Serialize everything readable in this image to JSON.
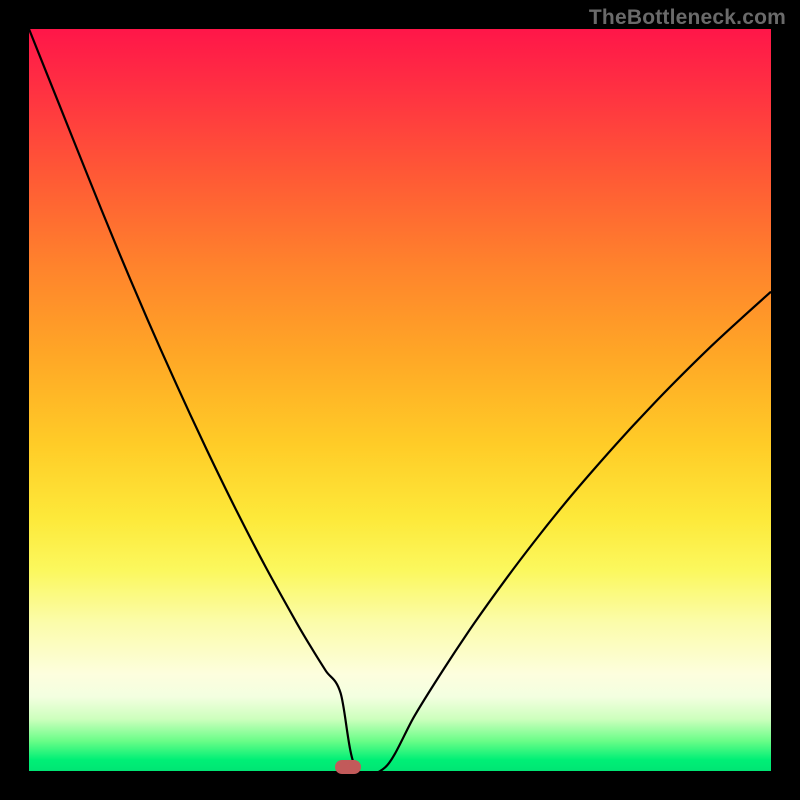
{
  "watermark": "TheBottleneck.com",
  "colors": {
    "frame": "#000000",
    "curve": "#000000",
    "marker": "#c25a5a"
  },
  "chart_data": {
    "type": "line",
    "title": "",
    "xlabel": "",
    "ylabel": "",
    "xlim": [
      0,
      100
    ],
    "ylim": [
      0,
      100
    ],
    "x": [
      0,
      4,
      8,
      12,
      16,
      20,
      24,
      28,
      32,
      36,
      38,
      40,
      42,
      44,
      48,
      52,
      56,
      60,
      64,
      68,
      72,
      76,
      80,
      84,
      88,
      92,
      96,
      100
    ],
    "values": [
      100,
      90,
      80,
      70.2,
      60.8,
      51.8,
      43.2,
      35,
      27.3,
      20.1,
      16.7,
      13.5,
      10.5,
      0.5,
      0.5,
      7.5,
      13.9,
      19.9,
      25.5,
      30.8,
      35.8,
      40.5,
      45,
      49.3,
      53.4,
      57.3,
      61,
      64.6
    ],
    "marker": {
      "x": 43,
      "y": 0.5
    },
    "gradient_stops": [
      {
        "pos": 0.0,
        "color": "#ff1649"
      },
      {
        "pos": 0.2,
        "color": "#ff5a35"
      },
      {
        "pos": 0.44,
        "color": "#ffa726"
      },
      {
        "pos": 0.66,
        "color": "#fde93a"
      },
      {
        "pos": 0.87,
        "color": "#fdfede"
      },
      {
        "pos": 0.96,
        "color": "#68fd87"
      },
      {
        "pos": 1.0,
        "color": "#00e574"
      }
    ]
  }
}
